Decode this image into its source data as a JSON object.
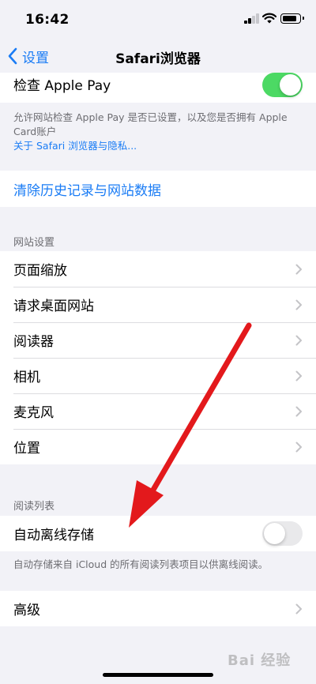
{
  "status_bar": {
    "time": "16:42"
  },
  "nav": {
    "back_label": "设置",
    "title": "Safari浏览器"
  },
  "apple_pay": {
    "label": "检查 Apple Pay",
    "toggle_on": true,
    "footer": "允许网站检查 Apple Pay 是否已设置，以及您是否拥有 Apple Card账户",
    "footer_link": "关于 Safari 浏览器与隐私..."
  },
  "clear_history": {
    "label": "清除历史记录与网站数据"
  },
  "website_settings": {
    "header": "网站设置",
    "items": [
      {
        "label": "页面缩放"
      },
      {
        "label": "请求桌面网站"
      },
      {
        "label": "阅读器"
      },
      {
        "label": "相机"
      },
      {
        "label": "麦克风"
      },
      {
        "label": "位置"
      }
    ]
  },
  "reading_list": {
    "header": "阅读列表",
    "label": "自动离线存储",
    "toggle_on": false,
    "footer": "自动存储来自 iCloud 的所有阅读列表项目以供离线阅读。"
  },
  "advanced": {
    "label": "高级"
  },
  "watermark": "Bai 经验",
  "colors": {
    "accent": "#1a7cf5",
    "toggle_on": "#4cd964",
    "arrow": "#e3191c"
  }
}
